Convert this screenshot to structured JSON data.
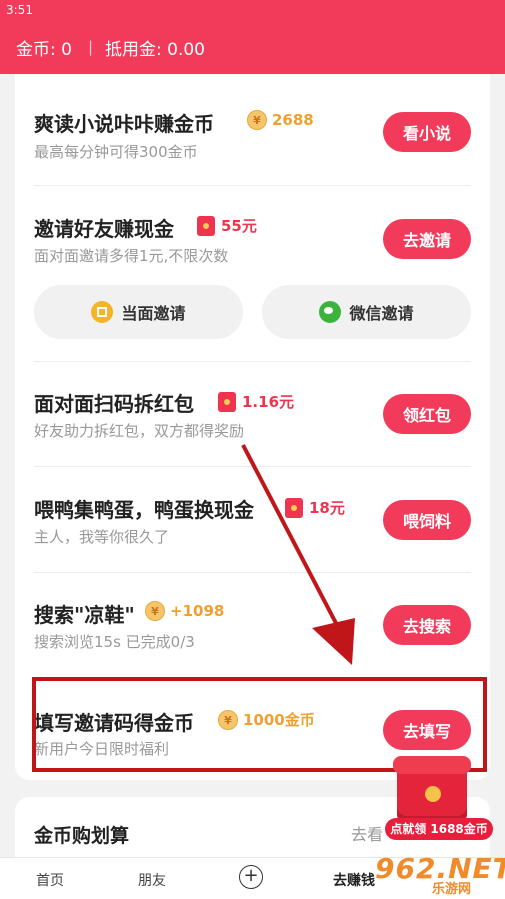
{
  "status_bar": {
    "time": "3:51"
  },
  "header": {
    "coins_label": "金币: 0",
    "separator": "|",
    "voucher_label": "抵用金: 0.00"
  },
  "tasks": [
    {
      "title": "爽读小说咔咔赚金币",
      "reward": "2688",
      "reward_icon": "coin-icon",
      "subtitle": "最高每分钟可得300金币",
      "button": "看小说"
    },
    {
      "title": "邀请好友赚现金",
      "reward": "55元",
      "reward_icon": "red-packet-icon",
      "subtitle": "面对面邀请多得1元,不限次数",
      "button": "去邀请"
    },
    {
      "title": "面对面扫码拆红包",
      "reward": "1.16元",
      "reward_icon": "red-packet-icon",
      "subtitle": "好友助力拆红包，双方都得奖励",
      "button": "领红包"
    },
    {
      "title": "喂鸭集鸭蛋，鸭蛋换现金",
      "reward": "18元",
      "reward_icon": "red-packet-icon",
      "subtitle": "主人，我等你很久了",
      "button": "喂饲料"
    },
    {
      "title": "搜索\"凉鞋\"",
      "reward": "+1098",
      "reward_icon": "coin-icon",
      "subtitle": "搜索浏览15s 已完成0/3",
      "button": "去搜索"
    },
    {
      "title": "填写邀请码得金币",
      "reward": "1000金币",
      "reward_icon": "coin-icon",
      "subtitle": "新用户今日限时福利",
      "button": "去填写"
    }
  ],
  "invite_options": {
    "face_to_face": "当面邀请",
    "wechat": "微信邀请"
  },
  "section2": {
    "title": "金币购划算",
    "more": "去看"
  },
  "floating_reward": {
    "label": "点就领 1688金币"
  },
  "tabbar": {
    "home": "首页",
    "friends": "朋友",
    "plus": "+",
    "earn": "去赚钱"
  },
  "watermark": {
    "text": "962.NET",
    "sub": "乐游网"
  },
  "colors": {
    "brand": "#f23a5a",
    "coin": "#f0a030",
    "red_reward": "#f0344f",
    "highlight_box": "#c0161a"
  }
}
